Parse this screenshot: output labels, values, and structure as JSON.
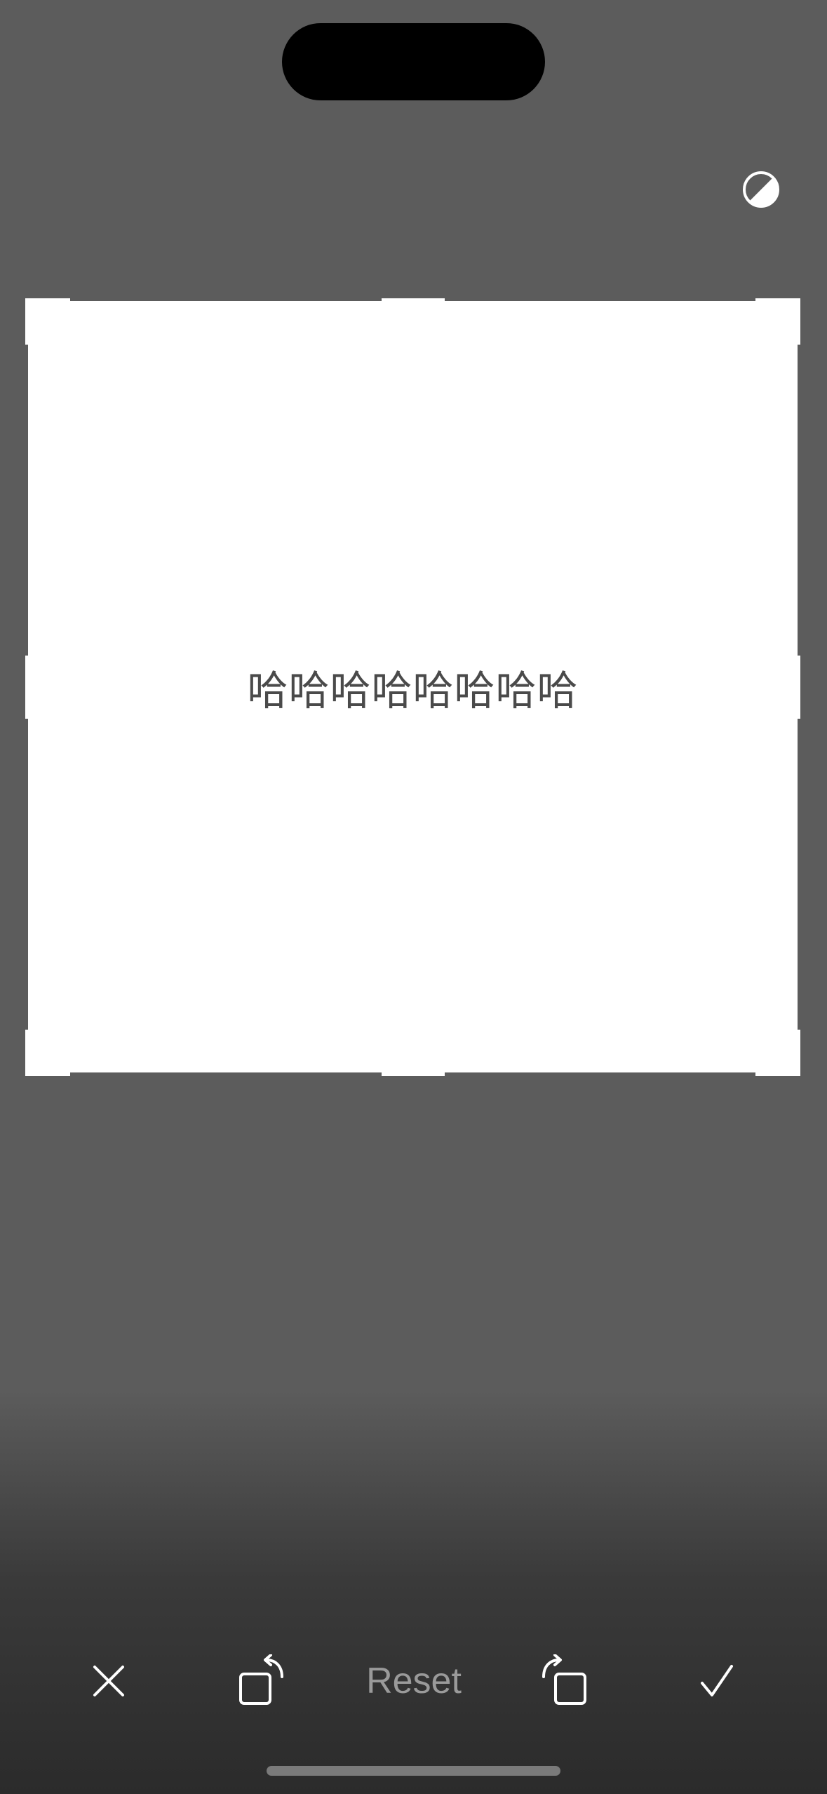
{
  "editor": {
    "caption": "哈哈哈哈哈哈哈哈"
  },
  "toolbar": {
    "reset_label": "Reset",
    "icons": [
      "close-icon",
      "rotate-left-icon",
      "rotate-right-icon",
      "checkmark-icon"
    ]
  },
  "top_controls": {
    "icons": [
      "contrast-icon"
    ]
  },
  "colors": {
    "background": "#5c5c5c",
    "frame": "#ffffff",
    "caption_text": "#4a4a4a",
    "reset_text": "#9a9a9a"
  }
}
